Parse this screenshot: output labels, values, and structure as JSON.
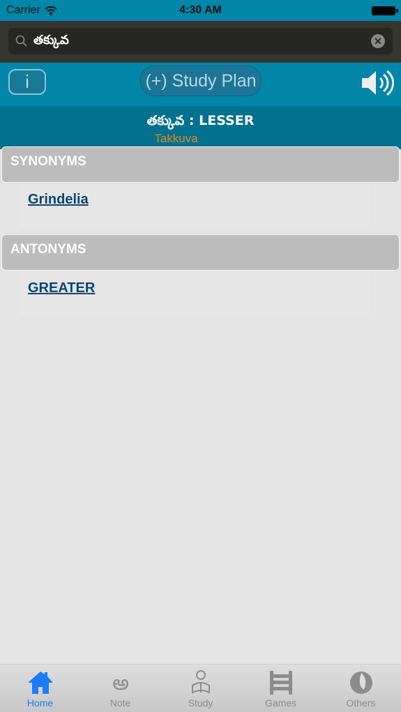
{
  "status": {
    "carrier": "Carrier",
    "time": "4:30 AM"
  },
  "search": {
    "value": "తక్కువ",
    "placeholder": ""
  },
  "toolbar": {
    "info_label": "i",
    "study_plan_label": "(+) Study Plan"
  },
  "entry": {
    "word": "తక్కువ : LESSER",
    "transliteration": "Takkuva"
  },
  "sections": [
    {
      "title": "SYNONYMS",
      "items": [
        "Grindelia"
      ]
    },
    {
      "title": "ANTONYMS",
      "items": [
        "GREATER"
      ]
    }
  ],
  "tabs": [
    {
      "label": "Home",
      "icon": "home-icon",
      "active": true
    },
    {
      "label": "Note",
      "icon": "note-icon"
    },
    {
      "label": "Study",
      "icon": "study-icon"
    },
    {
      "label": "Games",
      "icon": "abacus-icon"
    },
    {
      "label": "Others",
      "icon": "others-icon"
    }
  ],
  "colors": {
    "header": "#0086a8",
    "wordbar": "#00718f",
    "accent": "#1a7cff",
    "transliteration": "#e08a1e",
    "link": "#0e4670"
  }
}
